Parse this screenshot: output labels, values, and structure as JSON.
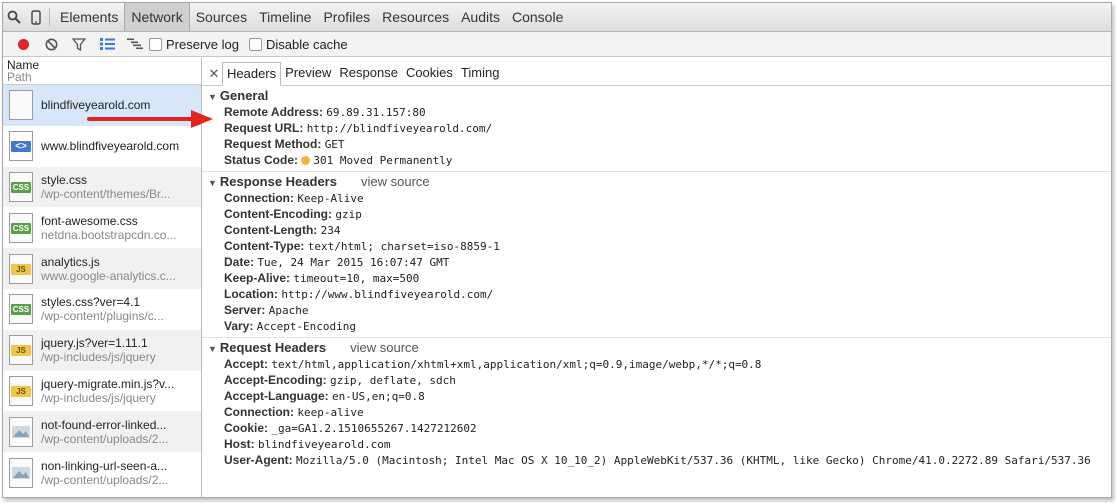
{
  "panels": [
    "Elements",
    "Network",
    "Sources",
    "Timeline",
    "Profiles",
    "Resources",
    "Audits",
    "Console"
  ],
  "toolbar": {
    "preserve_log": "Preserve log",
    "disable_cache": "Disable cache"
  },
  "list_header": {
    "name": "Name",
    "path": "Path"
  },
  "requests": [
    {
      "name": "blindfiveyearold.com",
      "path": "",
      "type": "blank"
    },
    {
      "name": "www.blindfiveyearold.com",
      "path": "",
      "type": "html"
    },
    {
      "name": "style.css",
      "path": "/wp-content/themes/Br...",
      "type": "css"
    },
    {
      "name": "font-awesome.css",
      "path": "netdna.bootstrapcdn.co...",
      "type": "css"
    },
    {
      "name": "analytics.js",
      "path": "www.google-analytics.c...",
      "type": "js"
    },
    {
      "name": "styles.css?ver=4.1",
      "path": "/wp-content/plugins/c...",
      "type": "css"
    },
    {
      "name": "jquery.js?ver=1.11.1",
      "path": "/wp-includes/js/jquery",
      "type": "js"
    },
    {
      "name": "jquery-migrate.min.js?v...",
      "path": "/wp-includes/js/jquery",
      "type": "js"
    },
    {
      "name": "not-found-error-linked...",
      "path": "/wp-content/uploads/2...",
      "type": "img"
    },
    {
      "name": "non-linking-url-seen-a...",
      "path": "/wp-content/uploads/2...",
      "type": "img"
    }
  ],
  "detail_tabs": [
    "Headers",
    "Preview",
    "Response",
    "Cookies",
    "Timing"
  ],
  "general": {
    "title": "General",
    "items": [
      {
        "k": "Remote Address:",
        "v": "69.89.31.157:80"
      },
      {
        "k": "Request URL:",
        "v": "http://blindfiveyearold.com/"
      },
      {
        "k": "Request Method:",
        "v": "GET"
      },
      {
        "k": "Status Code:",
        "v": "301 Moved Permanently"
      }
    ]
  },
  "response_headers": {
    "title": "Response Headers",
    "view_source": "view source",
    "items": [
      {
        "k": "Connection:",
        "v": "Keep-Alive"
      },
      {
        "k": "Content-Encoding:",
        "v": "gzip"
      },
      {
        "k": "Content-Length:",
        "v": "234"
      },
      {
        "k": "Content-Type:",
        "v": "text/html; charset=iso-8859-1"
      },
      {
        "k": "Date:",
        "v": "Tue, 24 Mar 2015 16:07:47 GMT"
      },
      {
        "k": "Keep-Alive:",
        "v": "timeout=10, max=500"
      },
      {
        "k": "Location:",
        "v": "http://www.blindfiveyearold.com/"
      },
      {
        "k": "Server:",
        "v": "Apache"
      },
      {
        "k": "Vary:",
        "v": "Accept-Encoding"
      }
    ]
  },
  "request_headers": {
    "title": "Request Headers",
    "view_source": "view source",
    "items": [
      {
        "k": "Accept:",
        "v": "text/html,application/xhtml+xml,application/xml;q=0.9,image/webp,*/*;q=0.8"
      },
      {
        "k": "Accept-Encoding:",
        "v": "gzip, deflate, sdch"
      },
      {
        "k": "Accept-Language:",
        "v": "en-US,en;q=0.8"
      },
      {
        "k": "Connection:",
        "v": "keep-alive"
      },
      {
        "k": "Cookie:",
        "v": "_ga=GA1.2.1510655267.1427212602"
      },
      {
        "k": "Host:",
        "v": "blindfiveyearold.com"
      },
      {
        "k": "User-Agent:",
        "v": "Mozilla/5.0 (Macintosh; Intel Mac OS X 10_10_2) AppleWebKit/537.36 (KHTML, like Gecko) Chrome/41.0.2272.89 Safari/537.36"
      }
    ]
  },
  "colors": {
    "record": "#e0242c",
    "status_dot": "#f2b73a",
    "arrow": "#e2261e",
    "selected_row": "#d7e6f8"
  }
}
